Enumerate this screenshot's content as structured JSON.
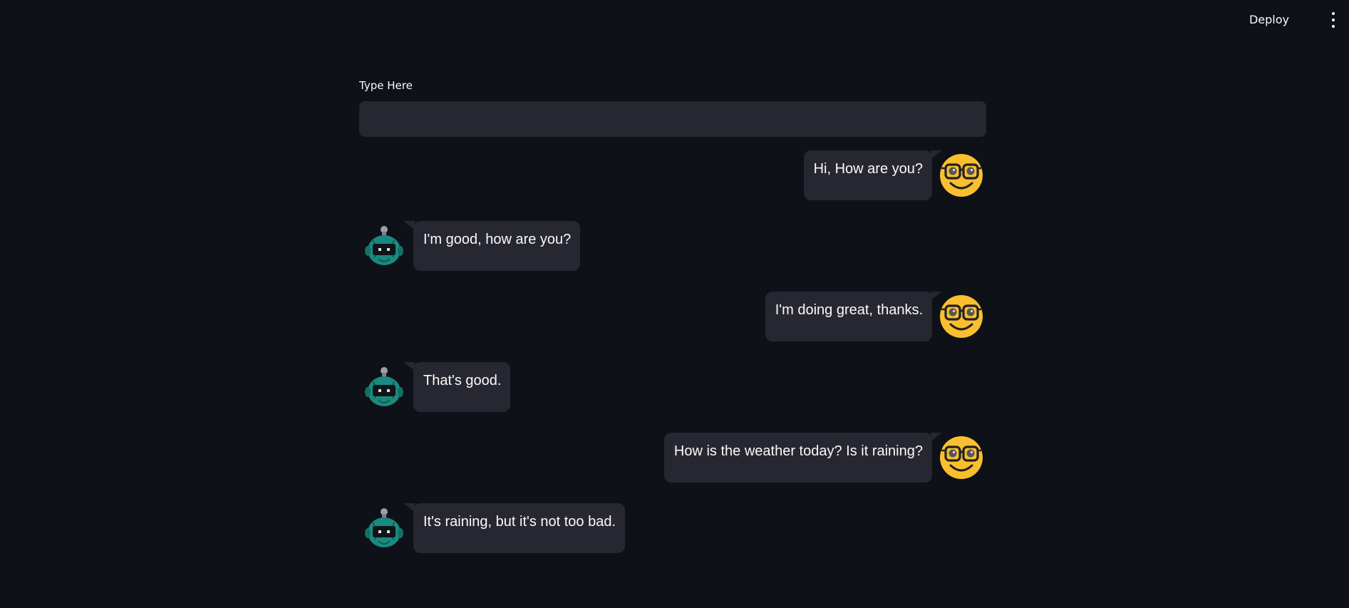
{
  "header": {
    "deploy_label": "Deploy",
    "menu_icon": "more-vertical-icon"
  },
  "input": {
    "label": "Type Here",
    "value": "",
    "placeholder": ""
  },
  "messages": [
    {
      "role": "user",
      "text": "Hi, How are you?",
      "avatar": "nerd-face-icon"
    },
    {
      "role": "bot",
      "text": "I'm good, how are you?",
      "avatar": "robot-icon"
    },
    {
      "role": "user",
      "text": "I'm doing great, thanks.",
      "avatar": "nerd-face-icon"
    },
    {
      "role": "bot",
      "text": "That's good.",
      "avatar": "robot-icon"
    },
    {
      "role": "user",
      "text": "How is the weather today? Is it raining?",
      "avatar": "nerd-face-icon"
    },
    {
      "role": "bot",
      "text": "It's raining, but it's not too bad.",
      "avatar": "robot-icon"
    }
  ],
  "colors": {
    "background": "#0e1117",
    "bubble": "#262730",
    "text": "#fafafa",
    "user_avatar": "#f9bf2f",
    "bot_avatar": "#1a8a80"
  }
}
